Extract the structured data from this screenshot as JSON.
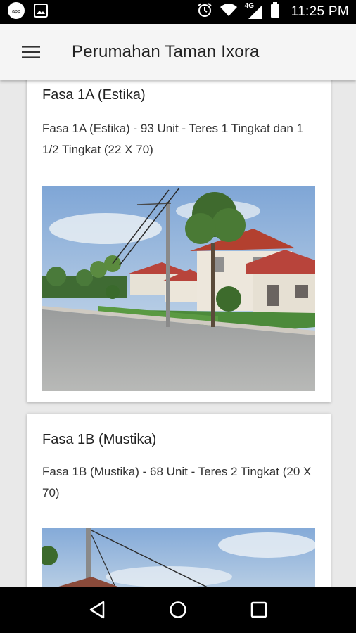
{
  "status_bar": {
    "time": "11:25 PM",
    "network_label": "4G",
    "icons": [
      "notification-app-icon",
      "image-icon",
      "alarm-icon",
      "wifi-icon",
      "signal-icon",
      "battery-icon"
    ]
  },
  "app_bar": {
    "title": "Perumahan Taman Ixora",
    "menu_icon": "hamburger-menu-icon"
  },
  "cards": [
    {
      "title": "Fasa 1A (Estika)",
      "description": "Fasa 1A (Estika) - 93 Unit - Teres 1 Tingkat dan 1 1/2 Tingkat (22 X 70)"
    },
    {
      "title": "Fasa 1B (Mustika)",
      "description": "Fasa 1B (Mustika) - 68 Unit - Teres 2 Tingkat (20 X 70)"
    }
  ],
  "nav_bar": {
    "icons": [
      "back-icon",
      "home-icon",
      "recent-apps-icon"
    ]
  },
  "colors": {
    "app_bar_bg": "#f5f5f5",
    "page_bg": "#e9e9e9",
    "status_bar_bg": "#000000"
  }
}
